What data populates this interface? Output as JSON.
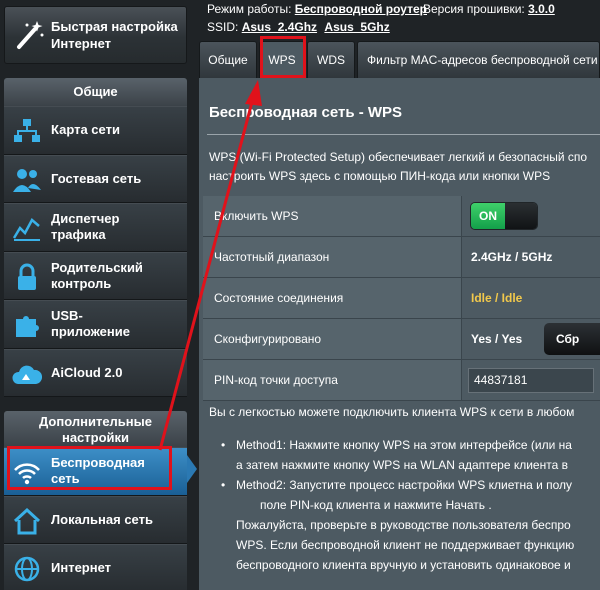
{
  "sidebar": {
    "quick_setup": {
      "label_line1": "Быстрая настройка",
      "label_line2": "Интернет",
      "icon": "wand-icon"
    },
    "general_header": "Общие",
    "general_items": [
      {
        "label_line1": "Карта сети",
        "label_line2": "",
        "icon": "network-map-icon"
      },
      {
        "label_line1": "Гостевая сеть",
        "label_line2": "",
        "icon": "guest-network-icon"
      },
      {
        "label_line1": "Диспетчер",
        "label_line2": "трафика",
        "icon": "traffic-manager-icon"
      },
      {
        "label_line1": "Родительский",
        "label_line2": "контроль",
        "icon": "parental-lock-icon"
      },
      {
        "label_line1": "USB-",
        "label_line2": "приложение",
        "icon": "usb-puzzle-icon"
      },
      {
        "label_line1": "AiCloud 2.0",
        "label_line2": "",
        "icon": "aicloud-icon"
      }
    ],
    "advanced_header_line1": "Дополнительные",
    "advanced_header_line2": "настройки",
    "advanced_items": [
      {
        "label_line1": "Беспроводная",
        "label_line2": "сеть",
        "icon": "wireless-icon",
        "active": true
      },
      {
        "label_line1": "Локальная сеть",
        "label_line2": "",
        "icon": "home-lan-icon"
      },
      {
        "label_line1": "Интернет",
        "label_line2": "",
        "icon": "globe-icon"
      }
    ]
  },
  "topinfo": {
    "mode_label": "Режим работы:",
    "mode_value": "Беспроводной роутер",
    "fw_label": "Версия прошивки:",
    "fw_value": "3.0.0",
    "ssid_label": "SSID:",
    "ssid_1": "Asus_2.4Ghz",
    "ssid_2": "Asus_5Ghz"
  },
  "tabs": [
    {
      "label": "Общие"
    },
    {
      "label": "WPS",
      "active": true
    },
    {
      "label": "WDS"
    },
    {
      "label": "Фильтр MAC-адресов беспроводной сети"
    }
  ],
  "main": {
    "title": "Беспроводная сеть - WPS",
    "desc_line1": "WPS (Wi-Fi Protected Setup) обеспечивает легкий и безопасный спо",
    "desc_line2": "настроить WPS здесь с помощью ПИН-кода или кнопки WPS",
    "rows": {
      "enable_label": "Включить WPS",
      "toggle_on": "ON",
      "band_label": "Частотный диапазон",
      "band_value": "2.4GHz / 5GHz",
      "status_label": "Состояние соединения",
      "status_value": "Idle / Idle",
      "configured_label": "Сконфигурировано",
      "configured_value": "Yes / Yes",
      "reset_button": "Сбр",
      "pin_label": "PIN-код точки доступа",
      "pin_value": "44837181"
    },
    "connect_text": "Вы с легкостью можете подключить клиента WPS к сети в любом",
    "method1_line1": "Method1: Нажмите кнопку WPS на этом интерфейсе (или на",
    "method1_line2": "а затем нажмите кнопку WPS на WLAN адаптере клиента в",
    "method2_line1": "Method2: Запустите процесс настройки WPS клиетна и полу",
    "method2_line2": "поле PIN-код клиента и нажмите Начать .",
    "method2_line3": "Пожалуйста, проверьте в руководстве пользователя беспро",
    "method2_line4": "WPS. Если беспроводной клиент не поддерживает функцию",
    "method2_line5": "беспроводного клиента вручную и установить одинаковое и"
  },
  "colors": {
    "annotation_red": "#e0121b",
    "active_blue": "#2b79b3",
    "toggle_green": "#13a04a",
    "status_yellow": "#f2c94c"
  }
}
